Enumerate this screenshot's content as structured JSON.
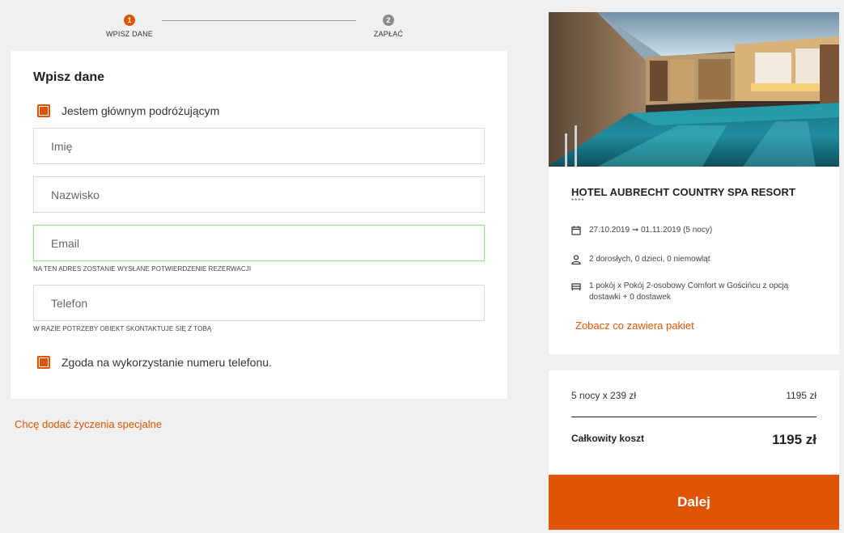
{
  "stepper": {
    "steps": [
      {
        "number": "1",
        "label": "WPISZ DANE"
      },
      {
        "number": "2",
        "label": "ZAPŁAĆ"
      }
    ]
  },
  "form": {
    "title": "Wpisz dane",
    "main_traveler_label": "Jestem głównym podróżującym",
    "first_name_placeholder": "Imię",
    "last_name_placeholder": "Nazwisko",
    "email_placeholder": "Email",
    "email_hint": "NA TEN ADRES ZOSTANIE WYSŁANE POTWIERDZENIE REZERWACJI",
    "phone_placeholder": "Telefon",
    "phone_hint": "W RAZIE POTRZEBY OBIEKT SKONTAKTUJE SIĘ Z TOBĄ",
    "phone_consent_label": "Zgoda na wykorzystanie numeru telefonu."
  },
  "special_requests_link": "Chcę dodać życzenia specjalne",
  "hotel": {
    "name": "HOTEL AUBRECHT COUNTRY SPA RESORT",
    "stars": "****",
    "dates": "27.10.2019 ➞ 01.11.2019 (5 nocy)",
    "guests": "2 dorosłych, 0 dzieci, 0 niemowląt",
    "room": "1 pokój x Pokój 2-osobowy Comfort w Gościńcu z opcją dostawki + 0 dostawek",
    "package_link": "Zobacz co zawiera pakiet"
  },
  "price": {
    "nights_label": "5 nocy x 239 zł",
    "nights_value": "1195 zł",
    "total_label": "Całkowity koszt",
    "total_value": "1195 zł"
  },
  "next_button": "Dalej",
  "colors": {
    "accent": "#e05300",
    "background": "#f0f0f0"
  }
}
